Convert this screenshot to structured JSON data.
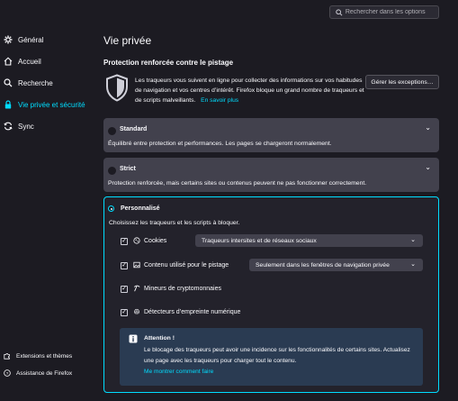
{
  "search": {
    "placeholder": "Rechercher dans les options"
  },
  "sidebar": {
    "items": [
      {
        "label": "Général",
        "icon": "gear-icon"
      },
      {
        "label": "Accueil",
        "icon": "home-icon"
      },
      {
        "label": "Recherche",
        "icon": "search-icon"
      },
      {
        "label": "Vie privée et sécurité",
        "icon": "lock-icon",
        "active": true
      },
      {
        "label": "Sync",
        "icon": "sync-icon"
      }
    ],
    "footer": [
      {
        "label": "Extensions et thèmes",
        "icon": "puzzle-icon"
      },
      {
        "label": "Assistance de Firefox",
        "icon": "help-icon"
      }
    ]
  },
  "main": {
    "page_title": "Vie privée",
    "section_title": "Protection renforcée contre le pistage",
    "description": "Les traqueurs vous suivent en ligne pour collecter des informations sur vos habitudes de navigation et vos centres d’intérêt. Firefox bloque un grand nombre de traqueurs et de scripts malveillants.",
    "learn_more": "En savoir plus",
    "manage_exceptions": "Gérer les exceptions…",
    "options": {
      "standard": {
        "title": "Standard",
        "desc": "Équilibré entre protection et performances. Les pages se chargeront normalement."
      },
      "strict": {
        "title": "Strict",
        "desc": "Protection renforcée, mais certains sites ou contenus peuvent ne pas fonctionner correctement."
      },
      "custom": {
        "title": "Personnalisé",
        "desc": "Choisissez les traqueurs et les scripts à bloquer.",
        "rows": {
          "cookies": {
            "label": "Cookies",
            "checked": true,
            "select": "Traqueurs intersites et de réseaux sociaux"
          },
          "content": {
            "label": "Contenu utilisé pour le pistage",
            "checked": true,
            "select": "Seulement dans les fenêtres de navigation privée"
          },
          "crypto": {
            "label": "Mineurs de cryptomonnaies",
            "checked": true
          },
          "fingerprint": {
            "label": "Détecteurs d’empreinte numérique",
            "checked": true
          }
        },
        "warning": {
          "title": "Attention !",
          "text": "Le blocage des traqueurs peut avoir une incidence sur les fonctionnalités de certains sites. Actualisez une page avec les traqueurs pour charger tout le contenu.",
          "link": "Me montrer comment faire"
        }
      }
    },
    "selected_option": "custom"
  },
  "colors": {
    "accent": "#00ddff",
    "background": "#1c1b22",
    "card": "#42414d",
    "info": "#2a3b52"
  }
}
